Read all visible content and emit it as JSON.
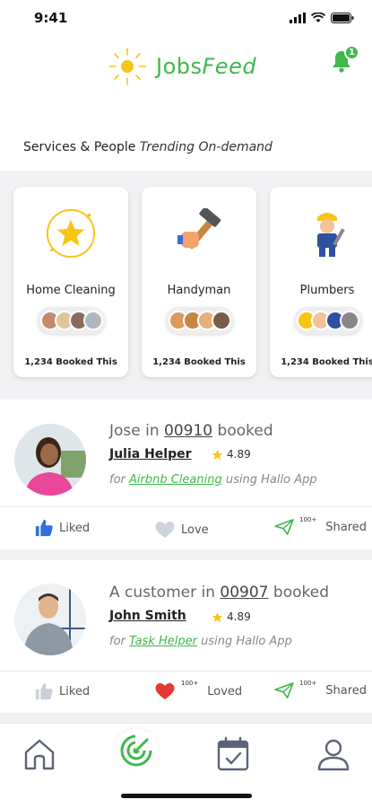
{
  "status_bar": {
    "time": "9:41"
  },
  "header": {
    "logo_part1": "Jobs",
    "logo_part2": "Feed",
    "notification_count": "1"
  },
  "section": {
    "title": "Services & People",
    "trending": "Trending On-demand"
  },
  "services": [
    {
      "name": "Home Cleaning",
      "booked": "1,234 Booked This"
    },
    {
      "name": "Handyman",
      "booked": "1,234 Booked This"
    },
    {
      "name": "Plumbers",
      "booked": "1,234 Booked This"
    }
  ],
  "feed": [
    {
      "who": "Jose in",
      "zip": "00910",
      "verb": "booked",
      "provider": "Julia Helper",
      "rating": "4.89",
      "for_text": "for",
      "service": "Airbnb Cleaning",
      "using": "using Hallo App",
      "actions": {
        "like": "Liked",
        "love": "Love",
        "share": "Shared",
        "share_count": "100+"
      }
    },
    {
      "who": "A customer in",
      "zip": "00907",
      "verb": "booked",
      "provider": "John Smith",
      "rating": "4.89",
      "for_text": "for",
      "service": "Task Helper",
      "using": "using Hallo App",
      "actions": {
        "like": "Liked",
        "love": "Loved",
        "love_count": "100+",
        "share": "Shared",
        "share_count": "100+"
      }
    }
  ],
  "colors": {
    "brand_green": "#3fb84a",
    "like_blue": "#2f6fe0",
    "love_red": "#e53935",
    "sun_yellow": "#f5c518"
  },
  "icons": {
    "nav": [
      "home-icon",
      "radar-icon",
      "calendar-icon",
      "profile-icon"
    ]
  }
}
